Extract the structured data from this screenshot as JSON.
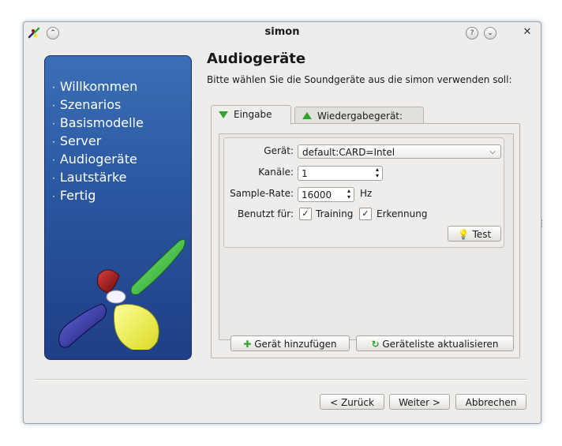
{
  "window": {
    "title": "simon"
  },
  "sidebar": {
    "items": [
      "Willkommen",
      "Szenarios",
      "Basismodelle",
      "Server",
      "Audiogeräte",
      "Lautstärke",
      "Fertig"
    ]
  },
  "page": {
    "title": "Audiogeräte",
    "subtitle": "Bitte wählen Sie die Soundgeräte aus die simon verwenden soll:"
  },
  "tabs": [
    {
      "label": "Eingabe",
      "active": true,
      "icon": "green-down-triangle-icon"
    },
    {
      "label": "Wiedergabegerät:",
      "active": false,
      "icon": "green-up-triangle-icon"
    }
  ],
  "form": {
    "device_label": "Gerät:",
    "device_value": "default:CARD=Intel",
    "channels_label": "Kanäle:",
    "channels_value": "1",
    "samplerate_label": "Sample-Rate:",
    "samplerate_value": "16000",
    "samplerate_unit": "Hz",
    "usedfor_label": "Benutzt für:",
    "training_label": "Training",
    "training_checked": true,
    "recognition_label": "Erkennung",
    "recognition_checked": true,
    "test_label": "Test"
  },
  "panel_buttons": {
    "add_device": "Gerät hinzufügen",
    "refresh_list": "Geräteliste aktualisieren"
  },
  "footer": {
    "back": "< Zurück",
    "next": "Weiter >",
    "cancel": "Abbrechen"
  },
  "colors": {
    "sidebar_top": "#3b6fb5",
    "sidebar_bottom": "#1f3f86",
    "accent_green": "#2fa52f"
  }
}
